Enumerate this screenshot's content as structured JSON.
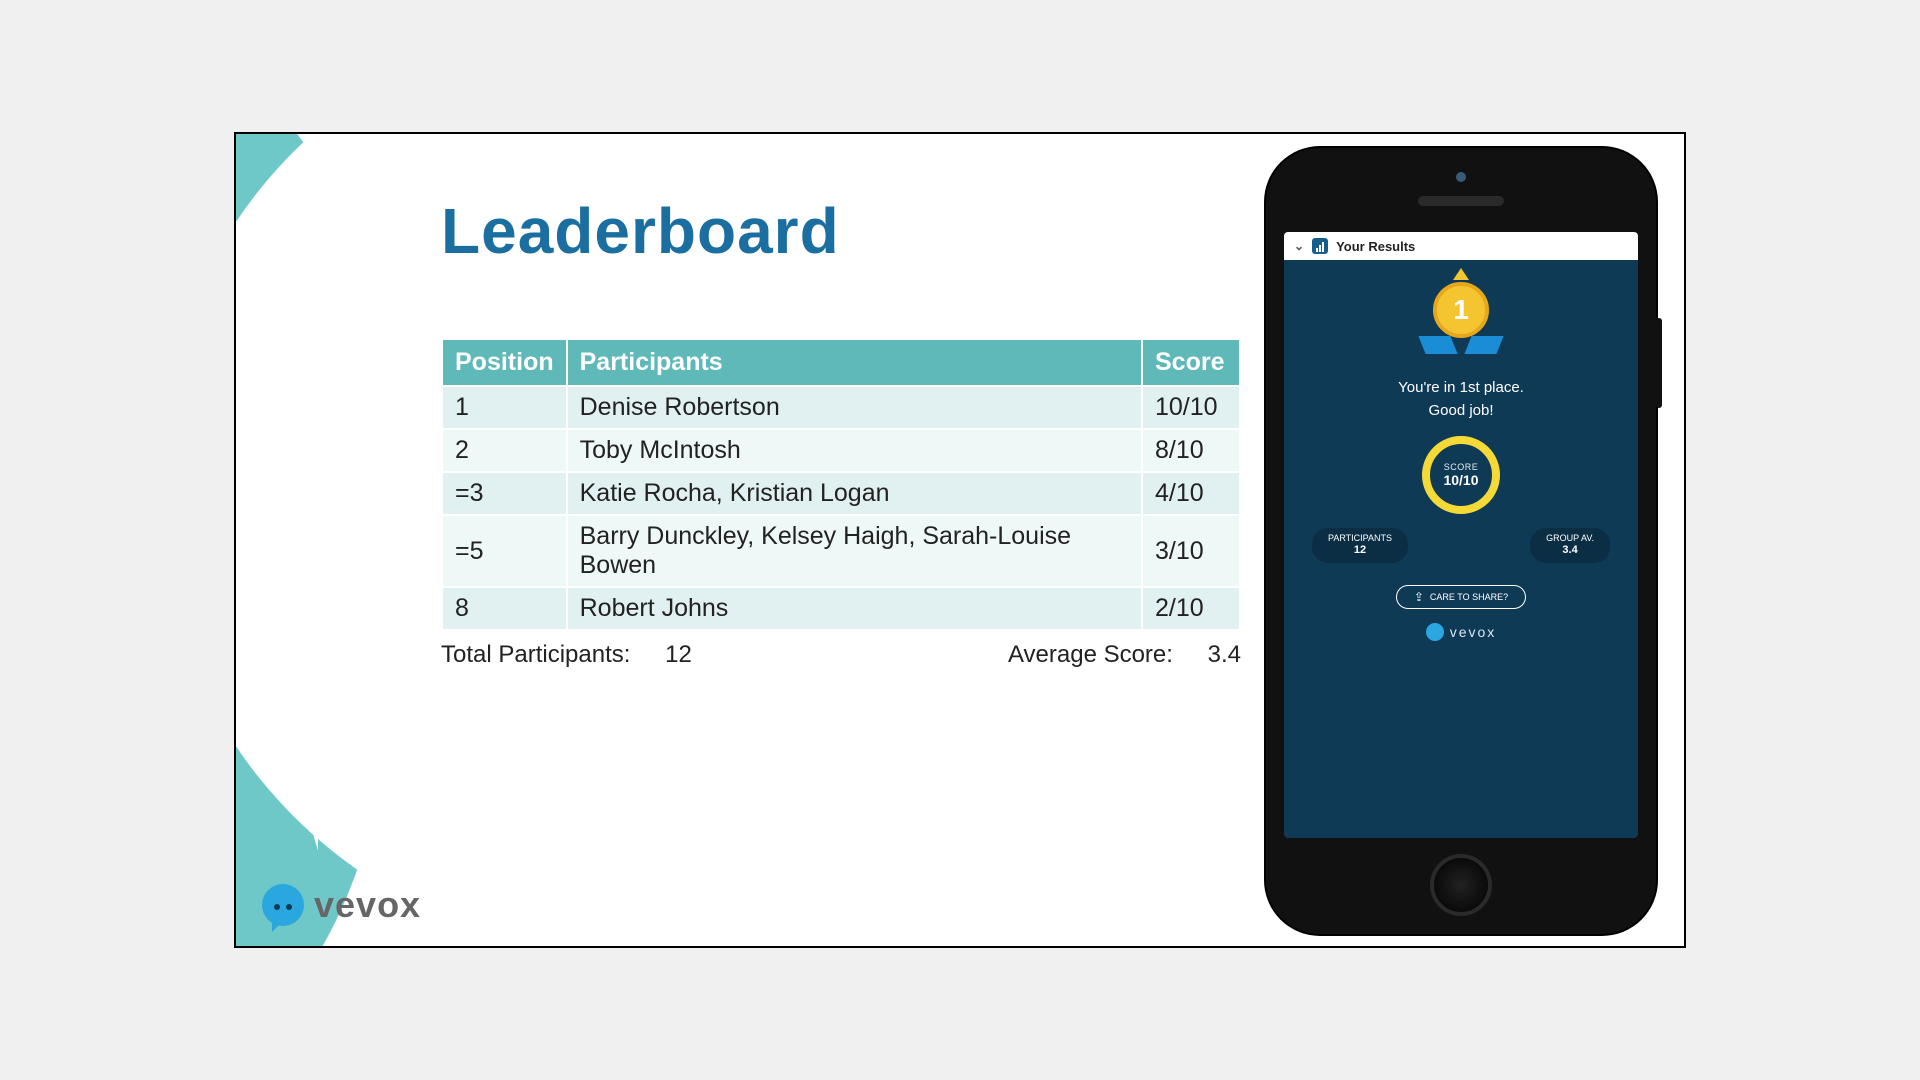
{
  "title": "Leaderboard",
  "columns": {
    "position": "Position",
    "participants": "Participants",
    "score": "Score"
  },
  "rows": [
    {
      "position": "1",
      "participants": "Denise Robertson",
      "score": "10/10"
    },
    {
      "position": "2",
      "participants": "Toby McIntosh",
      "score": "8/10"
    },
    {
      "position": "=3",
      "participants": "Katie Rocha, Kristian Logan",
      "score": "4/10"
    },
    {
      "position": "=5",
      "participants": "Barry Dunckley, Kelsey Haigh, Sarah-Louise Bowen",
      "score": "3/10"
    },
    {
      "position": "8",
      "participants": "Robert Johns",
      "score": "2/10"
    }
  ],
  "summary": {
    "total_label": "Total Participants:",
    "total_value": "12",
    "avg_label": "Average Score:",
    "avg_value": "3.4"
  },
  "phone": {
    "topbar_title": "Your Results",
    "medal_rank": "1",
    "place_line1": "You're in 1st place.",
    "place_line2": "Good job!",
    "score_label": "SCORE",
    "score_value": "10/10",
    "participants_label": "PARTICIPANTS",
    "participants_value": "12",
    "groupav_label": "GROUP AV.",
    "groupav_value": "3.4",
    "share_label": "CARE TO SHARE?",
    "brand": "vevox"
  },
  "footer_brand": "vevox"
}
